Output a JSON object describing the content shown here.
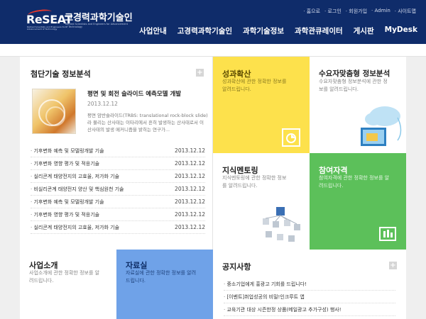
{
  "brand": {
    "logo_text": "ReSEAT",
    "logo_subtext": "Retired Scientists and Engineers for Advancement of Technology",
    "title": "고경력과학기술인",
    "subtitle": "Retired Scientists and Engineers for Advancement of Technology"
  },
  "utility_links": [
    "홈으로",
    "로그인",
    "회원가입",
    "Admin",
    "사이트맵"
  ],
  "main_nav": [
    "사업안내",
    "고경력과학기술인",
    "과학기술정보",
    "과학관큐레이터",
    "게시판",
    "MyDesk"
  ],
  "trend": {
    "title": "첨단기술 정보분석",
    "more": "+",
    "feature": {
      "title": "평면 및 회전 슬라이드 예측모델 개발",
      "date": "2013.12.12",
      "desc": "평면 암반슬라이드(TRBS: translational rock-block slide)라 불리는 산사태는 이타리에서 흔히 발생하는 산사태로서 이 산사태의 발생 메커니즘을 밝히는 연구가..."
    },
    "items": [
      {
        "title": "기후변화 예측 및 모델링개발 기술",
        "date": "2013.12.12"
      },
      {
        "title": "기후변화 영향 평가 및 적응기술",
        "date": "2013.12.12"
      },
      {
        "title": "실리콘계 태양전지의 고효율, 저가화 기술",
        "date": "2013.12.12"
      },
      {
        "title": "비실리콘계 태양전지 양산 및 핵심원천 기술",
        "date": "2013.12.12"
      },
      {
        "title": "기후변화 예측 및 모델링개발 기술",
        "date": "2013.12.12"
      },
      {
        "title": "기후변화 영향 평가 및 적응기술",
        "date": "2013.12.12"
      },
      {
        "title": "실리콘계 태양전지의 고효율, 저가화 기술",
        "date": "2013.12.12"
      }
    ]
  },
  "tiles": {
    "achievement": {
      "title": "성과확산",
      "desc": "성과확산에 관한 정확한 정보를 알려드립니다."
    },
    "custom": {
      "title": "수요자맞춤형 정보분석",
      "desc": "수요자맞춤형 정보분석에 관한 정보를 알려드립니다."
    },
    "mentoring": {
      "title": "지식멘토링",
      "desc": "지식멘토링에 관한 정확한 정보를 알려드립니다."
    },
    "participation": {
      "title": "참여자격",
      "desc": "참여자격에 관한 정확한 정보를 알려드립니다."
    },
    "business": {
      "title": "사업소개",
      "desc": "사업소개에 관한 정확한 정보를 알려드립니다."
    },
    "library": {
      "title": "자료실",
      "desc": "자료실에 관한 정확한 정보를 알려드립니다."
    }
  },
  "notice": {
    "title": "공지사항",
    "more": "+",
    "items": [
      "중소기업에게 홍광고 기회를 드립니다!",
      "[이벤트]취업성공의 비밀!인크루트 앱",
      "교육기관 대상 시즌한정 상품(메일광고 추가구성) 행사!"
    ]
  },
  "colors": {
    "header": "#0f2c6a",
    "yellow": "#fde14c",
    "green": "#5cc05a",
    "blue": "#6fa2e8"
  }
}
